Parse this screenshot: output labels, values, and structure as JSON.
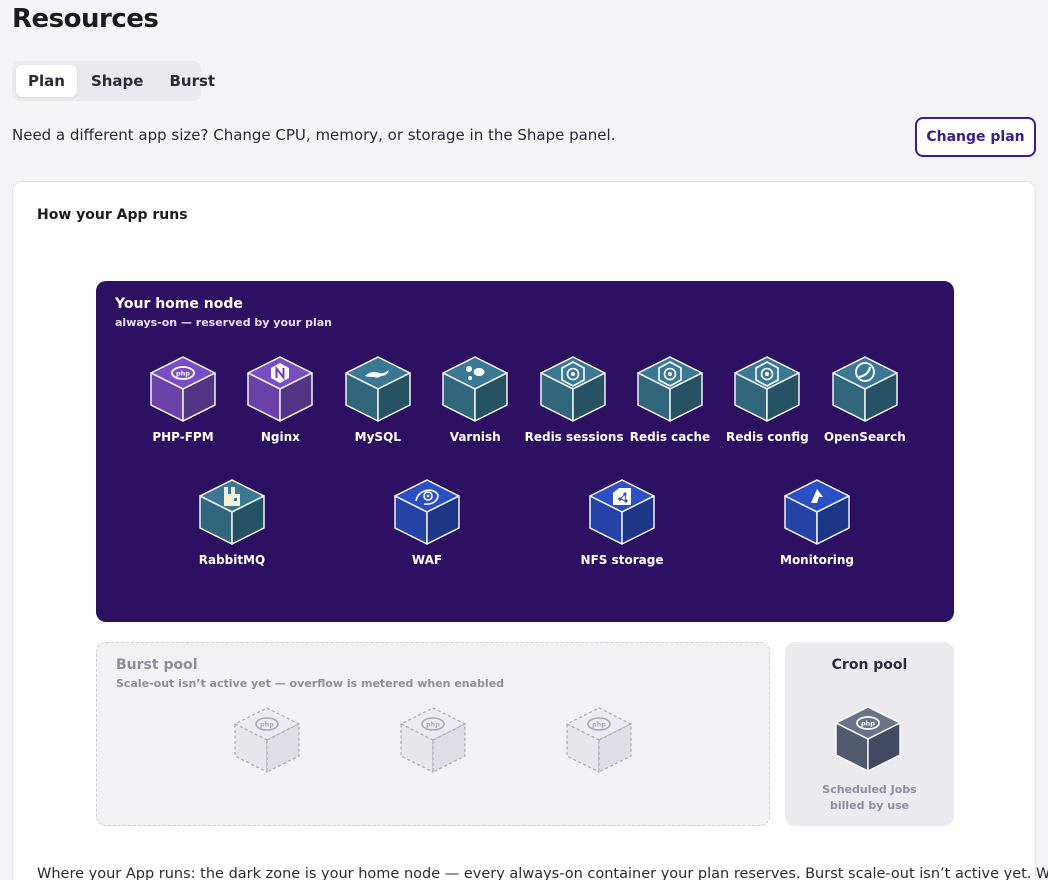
{
  "page": {
    "title": "Resources"
  },
  "tabs": [
    {
      "label": "Plan",
      "active": true
    },
    {
      "label": "Shape",
      "active": false
    },
    {
      "label": "Burst",
      "active": false
    }
  ],
  "plan_note": "Need a different app size? Change CPU, memory, or storage in the Shape panel.",
  "change_plan_label": "Change plan",
  "card": {
    "title": "How your App runs",
    "home_node": {
      "title": "Your home node",
      "subtitle": "always-on — reserved by your plan",
      "services": [
        {
          "label": "PHP-FPM",
          "icon": "php-icon",
          "color": "#7b4dc4"
        },
        {
          "label": "Nginx",
          "icon": "nginx-icon",
          "color": "#7b4dc4"
        },
        {
          "label": "MySQL",
          "icon": "mysql-icon",
          "color": "#3a7893"
        },
        {
          "label": "Varnish",
          "icon": "varnish-icon",
          "color": "#3a7893"
        },
        {
          "label": "Redis sessions",
          "icon": "redis-icon",
          "color": "#3a7893"
        },
        {
          "label": "Redis cache",
          "icon": "redis-icon",
          "color": "#3a7893"
        },
        {
          "label": "Redis config",
          "icon": "redis-icon",
          "color": "#3a7893"
        },
        {
          "label": "OpenSearch",
          "icon": "opensearch-icon",
          "color": "#3a7893"
        },
        {
          "label": "RabbitMQ",
          "icon": "rabbitmq-icon",
          "color": "#3a7893"
        },
        {
          "label": "WAF",
          "icon": "waf-icon",
          "color": "#2b4fc4"
        },
        {
          "label": "NFS storage",
          "icon": "nfs-icon",
          "color": "#2b4fc4"
        },
        {
          "label": "Monitoring",
          "icon": "monitoring-icon",
          "color": "#2b4fc4"
        }
      ]
    },
    "burst_pool": {
      "title": "Burst pool",
      "subtitle": "Scale-out isn’t active yet — overflow is metered when enabled",
      "ghost_count": 3
    },
    "cron_pool": {
      "title": "Cron pool",
      "line1": "Scheduled Jobs",
      "line2": "billed by use"
    },
    "description": "Where your App runs: the dark zone is your home node — every always-on container your plan reserves. Burst scale-out isn’t active yet. When"
  }
}
